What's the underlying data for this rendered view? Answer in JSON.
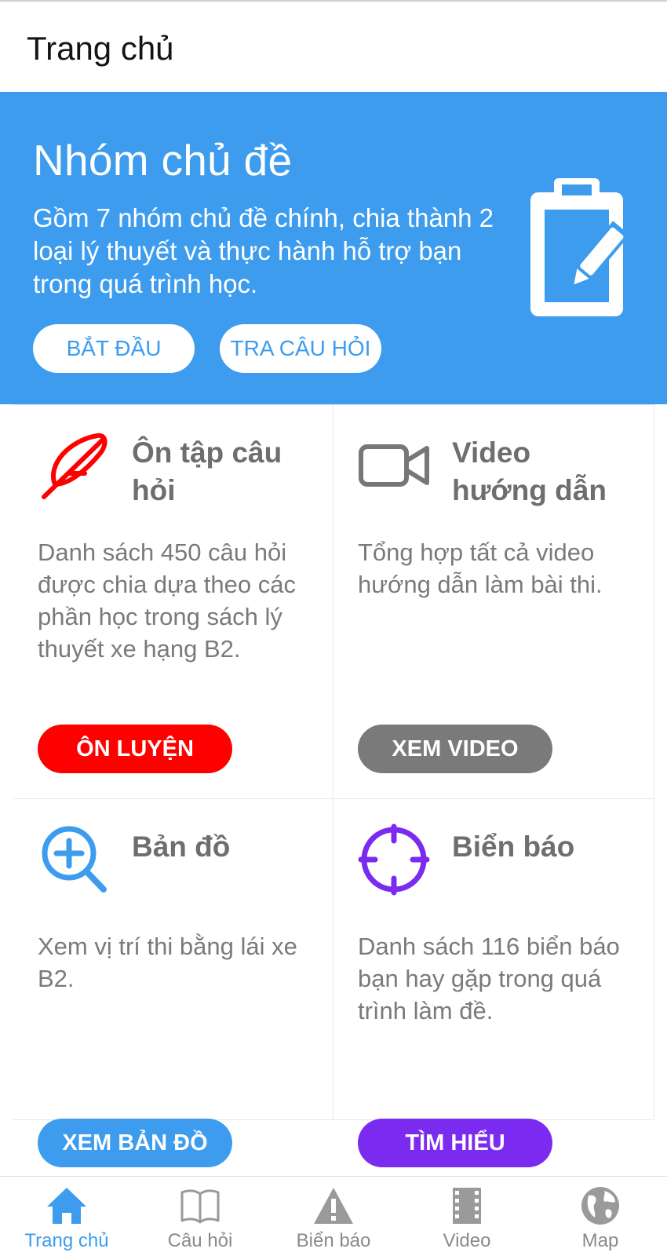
{
  "header": {
    "title": "Trang chủ"
  },
  "banner": {
    "title": "Nhóm chủ đề",
    "description": "Gồm 7 nhóm chủ đề chính, chia thành 2 loại lý thuyết và thực hành hỗ trợ bạn trong quá trình học.",
    "start_label": "BẮT ĐẦU",
    "lookup_label": "TRA CÂU HỎI",
    "icon": "clipboard-edit-icon",
    "background": "#3d9cee"
  },
  "cards": [
    {
      "title": "Ôn tập câu hỏi",
      "description": "Danh sách 450 câu hỏi được chia dựa theo các phần học trong sách lý thuyết xe hạng B2.",
      "button": "ÔN LUYỆN",
      "color": "#ff0000",
      "icon": "feather-icon"
    },
    {
      "title": "Video hướng dẫn",
      "description": "Tổng hợp tất cả video hướng dẫn làm bài thi.",
      "button": "XEM VIDEO",
      "color": "#7a7a7a",
      "icon": "video-camera-icon"
    },
    {
      "title": "Bản đồ",
      "description": "Xem vị trí thi bằng lái xe B2.",
      "button": "XEM BẢN ĐỒ",
      "color": "#3d9cee",
      "icon": "zoom-in-icon"
    },
    {
      "title": "Biển báo",
      "description": "Danh sách 116 biển báo bạn hay gặp trong quá trình làm đề.",
      "button": "TÌM HIỂU",
      "color": "#7b2bf0",
      "icon": "crosshair-icon"
    }
  ],
  "tabs": [
    {
      "label": "Trang chủ",
      "icon": "home-icon",
      "active": true
    },
    {
      "label": "Câu hỏi",
      "icon": "book-icon",
      "active": false
    },
    {
      "label": "Biển báo",
      "icon": "warning-icon",
      "active": false
    },
    {
      "label": "Video",
      "icon": "film-icon",
      "active": false
    },
    {
      "label": "Map",
      "icon": "globe-icon",
      "active": false
    }
  ]
}
